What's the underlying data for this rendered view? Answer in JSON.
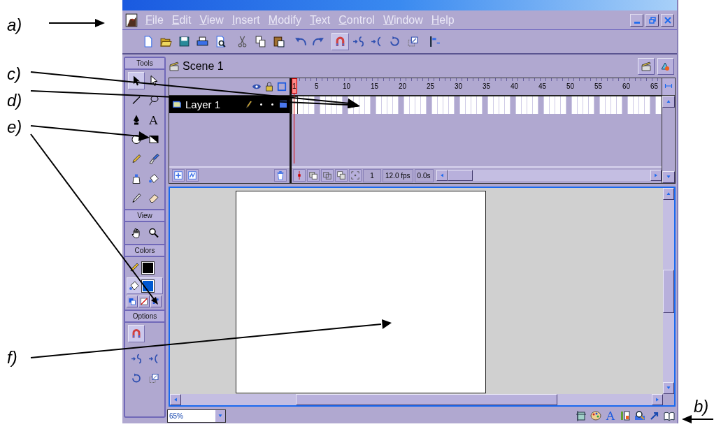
{
  "annotations": [
    "a)",
    "b)",
    "c)",
    "d)",
    "e)",
    "f)"
  ],
  "menu": [
    "File",
    "Edit",
    "View",
    "Insert",
    "Modify",
    "Text",
    "Control",
    "Window",
    "Help"
  ],
  "toolbar": [
    {
      "kind": "new",
      "selected": false
    },
    {
      "kind": "open",
      "selected": false
    },
    {
      "kind": "save",
      "selected": false
    },
    {
      "kind": "print",
      "selected": false
    },
    {
      "kind": "preview",
      "selected": false
    },
    {
      "kind": "cut",
      "selected": false
    },
    {
      "kind": "copy",
      "selected": false
    },
    {
      "kind": "paste",
      "selected": false
    },
    {
      "kind": "undo",
      "selected": false
    },
    {
      "kind": "redo",
      "selected": false
    },
    {
      "kind": "snap",
      "selected": true
    },
    {
      "kind": "smooth",
      "selected": false
    },
    {
      "kind": "straighten",
      "selected": false
    },
    {
      "kind": "rotate",
      "selected": false
    },
    {
      "kind": "scale",
      "selected": false
    },
    {
      "kind": "align",
      "selected": false
    }
  ],
  "tools_panel": {
    "title": "Tools",
    "tools": [
      {
        "kind": "arrow",
        "selected": true
      },
      {
        "kind": "subselect",
        "selected": false
      },
      {
        "kind": "line",
        "selected": false
      },
      {
        "kind": "lasso",
        "selected": false
      },
      {
        "kind": "pen",
        "selected": false
      },
      {
        "kind": "text",
        "glyph": "A",
        "selected": false
      },
      {
        "kind": "oval",
        "selected": false
      },
      {
        "kind": "rect",
        "selected": false
      },
      {
        "kind": "pencil",
        "selected": false
      },
      {
        "kind": "brush",
        "selected": false
      },
      {
        "kind": "ink",
        "selected": false
      },
      {
        "kind": "paint",
        "selected": false
      },
      {
        "kind": "dropper",
        "selected": false
      },
      {
        "kind": "eraser",
        "selected": false
      }
    ]
  },
  "view": {
    "title": "View",
    "tools": [
      {
        "kind": "hand",
        "selected": false
      },
      {
        "kind": "zoom",
        "selected": false
      }
    ]
  },
  "colors": {
    "title": "Colors",
    "stroke": {
      "color": "#000000",
      "selected": false
    },
    "fill": {
      "color": "#0058d0",
      "selected": true
    }
  },
  "options": {
    "title": "Options",
    "items": [
      {
        "kind": "snap",
        "selected": true
      },
      {
        "kind": "smooth",
        "selected": false
      },
      {
        "kind": "straighten",
        "selected": false
      },
      {
        "kind": "rotate",
        "selected": false
      },
      {
        "kind": "scale",
        "selected": false
      }
    ]
  },
  "scene": {
    "name": "Scene 1"
  },
  "timeline": {
    "frame_numbers": [
      "1",
      "5",
      "10",
      "15",
      "20",
      "25",
      "30",
      "35",
      "40",
      "45",
      "50",
      "55",
      "60",
      "65"
    ],
    "layers": [
      {
        "name": "Layer 1",
        "selected": true
      }
    ],
    "current_frame": "1",
    "frame_rate": "12.0 fps",
    "elapsed_time": "0.0s"
  },
  "status_bar": {
    "zoom": "65%",
    "panels": [
      {
        "kind": "info"
      },
      {
        "kind": "mixer"
      },
      {
        "kind": "character",
        "glyph": "A"
      },
      {
        "kind": "swatches"
      },
      {
        "kind": "explorer"
      },
      {
        "kind": "actions"
      },
      {
        "kind": "library"
      }
    ]
  }
}
